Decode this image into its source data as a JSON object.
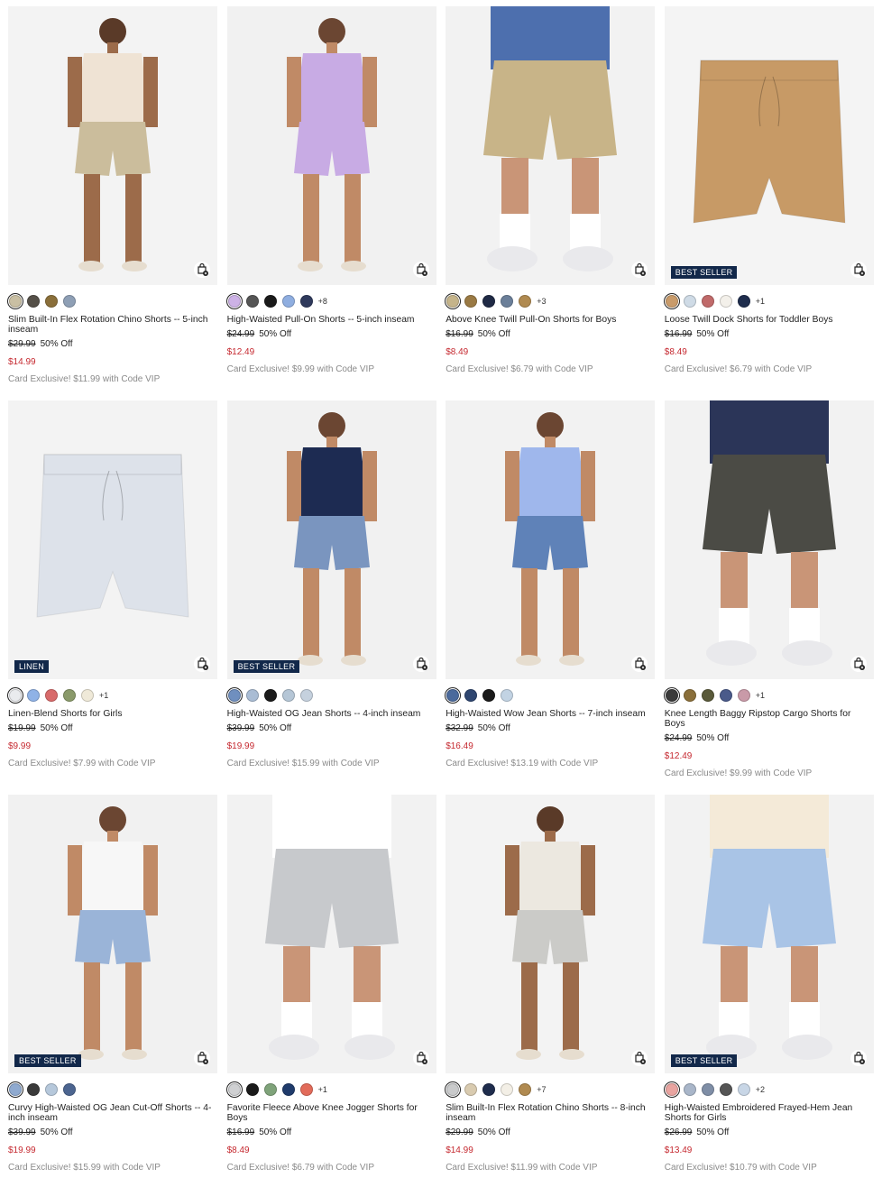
{
  "products": [
    {
      "name": "Slim Built-In Flex Rotation Chino Shorts -- 5-inch inseam",
      "was": "$29.99",
      "discount": "50% Off",
      "price": "$14.99",
      "vip": "Card Exclusive! $11.99 with Code VIP",
      "badge": "",
      "swatches": [
        "#c9bfa3",
        "#555048",
        "#8a6f3a",
        "#8e9fb5"
      ],
      "more": "",
      "bg": "#f3f3f3",
      "garment": "#cbbd9c",
      "top": "#efe3d4",
      "kind": "man"
    },
    {
      "name": "High-Waisted Pull-On Shorts -- 5-inch inseam",
      "was": "$24.99",
      "discount": "50% Off",
      "price": "$12.49",
      "vip": "Card Exclusive! $9.99 with Code VIP",
      "badge": "",
      "swatches": [
        "#cdb2e6",
        "#555",
        "#1a1a1a",
        "#8faee0",
        "#2f3a5c"
      ],
      "more": "+8",
      "bg": "#f1f1f1",
      "garment": "#c8abe4",
      "top": "#c8abe4",
      "kind": "woman"
    },
    {
      "name": "Above Knee Twill Pull-On Shorts for Boys",
      "was": "$16.99",
      "discount": "50% Off",
      "price": "$8.49",
      "vip": "Card Exclusive! $6.79 with Code VIP",
      "badge": "",
      "swatches": [
        "#c5b48a",
        "#9a7a44",
        "#1f2a45",
        "#6b7f99",
        "#b08a50"
      ],
      "more": "+3",
      "bg": "#f2f2f2",
      "garment": "#c8b488",
      "top": "#4d6fae",
      "kind": "legs"
    },
    {
      "name": "Loose Twill Dock Shorts for Toddler Boys",
      "was": "$16.99",
      "discount": "50% Off",
      "price": "$8.49",
      "vip": "Card Exclusive! $6.79 with Code VIP",
      "badge": "BEST SELLER",
      "swatches": [
        "#c99b6a",
        "#cfdbe6",
        "#c06a6a",
        "#f3f0ea",
        "#1f2d4d"
      ],
      "more": "+1",
      "bg": "#f4f4f4",
      "garment": "#c79a66",
      "top": "",
      "kind": "flat"
    },
    {
      "name": "Linen-Blend Shorts for Girls",
      "was": "$19.99",
      "discount": "50% Off",
      "price": "$9.99",
      "vip": "Card Exclusive! $7.99 with Code VIP",
      "badge": "LINEN",
      "swatches": [
        "#e9ebee",
        "#8fb2e6",
        "#d86a6a",
        "#8a9a6a",
        "#efe9d8"
      ],
      "more": "+1",
      "bg": "#f3f3f3",
      "garment": "#dde2ea",
      "top": "",
      "kind": "flat"
    },
    {
      "name": "High-Waisted OG Jean Shorts -- 4-inch inseam",
      "was": "$39.99",
      "discount": "50% Off",
      "price": "$19.99",
      "vip": "Card Exclusive! $15.99 with Code VIP",
      "badge": "BEST SELLER",
      "swatches": [
        "#6f8fbf",
        "#a9bcd4",
        "#1a1a1a",
        "#b5c6d6",
        "#c5d1de"
      ],
      "more": "",
      "bg": "#f1f1f1",
      "garment": "#7a95bf",
      "top": "#1d2b52",
      "kind": "woman"
    },
    {
      "name": "High-Waisted Wow Jean Shorts -- 7-inch inseam",
      "was": "$32.99",
      "discount": "50% Off",
      "price": "$16.49",
      "vip": "Card Exclusive! $13.19 with Code VIP",
      "badge": "",
      "swatches": [
        "#4b6a9c",
        "#2f4670",
        "#1a1a1a",
        "#c2d3e3"
      ],
      "more": "",
      "bg": "#f2f2f2",
      "garment": "#5f82b8",
      "top": "#9fb7ec",
      "kind": "woman"
    },
    {
      "name": "Knee Length Baggy Ripstop Cargo Shorts for Boys",
      "was": "$24.99",
      "discount": "50% Off",
      "price": "$12.49",
      "vip": "Card Exclusive! $9.99 with Code VIP",
      "badge": "",
      "swatches": [
        "#3a3a3a",
        "#8a6f3a",
        "#5a5a3a",
        "#4a5a8a",
        "#c99aa8"
      ],
      "more": "+1",
      "bg": "#f2f2f2",
      "garment": "#4b4b45",
      "top": "#2b3558",
      "kind": "legs"
    },
    {
      "name": "Curvy High-Waisted OG Jean Cut-Off Shorts -- 4-inch inseam",
      "was": "$39.99",
      "discount": "50% Off",
      "price": "$19.99",
      "vip": "Card Exclusive! $15.99 with Code VIP",
      "badge": "BEST SELLER",
      "swatches": [
        "#8faad0",
        "#3a3a3a",
        "#b6c8db",
        "#4c6590"
      ],
      "more": "",
      "bg": "#f1f1f1",
      "garment": "#9ab4d8",
      "top": "#f7f7f7",
      "kind": "woman"
    },
    {
      "name": "Favorite Fleece Above Knee Jogger Shorts for Boys",
      "was": "$16.99",
      "discount": "50% Off",
      "price": "$8.49",
      "vip": "Card Exclusive! $6.79 with Code VIP",
      "badge": "",
      "swatches": [
        "#cfd0d2",
        "#1a1a1a",
        "#7fa37a",
        "#1f3b6b",
        "#e26b5a"
      ],
      "more": "+1",
      "bg": "#f2f2f2",
      "garment": "#c7c9cc",
      "top": "#ffffff",
      "kind": "legs"
    },
    {
      "name": "Slim Built-In Flex Rotation Chino Shorts -- 8-inch inseam",
      "was": "$29.99",
      "discount": "50% Off",
      "price": "$14.99",
      "vip": "Card Exclusive! $11.99 with Code VIP",
      "badge": "",
      "swatches": [
        "#c9cacb",
        "#d9cbb0",
        "#1f2d4d",
        "#f3efe6",
        "#b08a50"
      ],
      "more": "+7",
      "bg": "#f3f3f3",
      "garment": "#cbcbc8",
      "top": "#ece8e0",
      "kind": "man"
    },
    {
      "name": "High-Waisted Embroidered Frayed-Hem Jean Shorts for Girls",
      "was": "$26.99",
      "discount": "50% Off",
      "price": "$13.49",
      "vip": "Card Exclusive! $10.79 with Code VIP",
      "badge": "BEST SELLER",
      "swatches": [
        "#e9a4a0",
        "#a9b6c9",
        "#7f8ea6",
        "#555",
        "#c8d6e6"
      ],
      "more": "+2",
      "bg": "#f2f2f2",
      "garment": "#a9c4e6",
      "top": "#f4ead8",
      "kind": "legs"
    }
  ]
}
